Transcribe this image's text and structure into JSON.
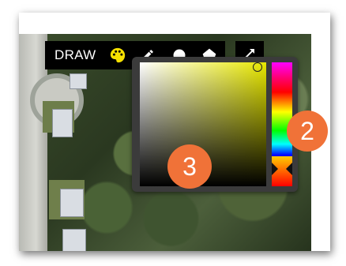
{
  "toolbar": {
    "draw_label": "DRAW",
    "tools": [
      "palette-icon",
      "pencil-icon",
      "circle-icon",
      "polygon-icon"
    ],
    "expand_icon": "expand-arrow-icon"
  },
  "color_picker": {
    "selected_hue": "#e8e800"
  },
  "callouts": {
    "hue_callout": "2",
    "square_callout": "3",
    "color": "#f07238"
  }
}
